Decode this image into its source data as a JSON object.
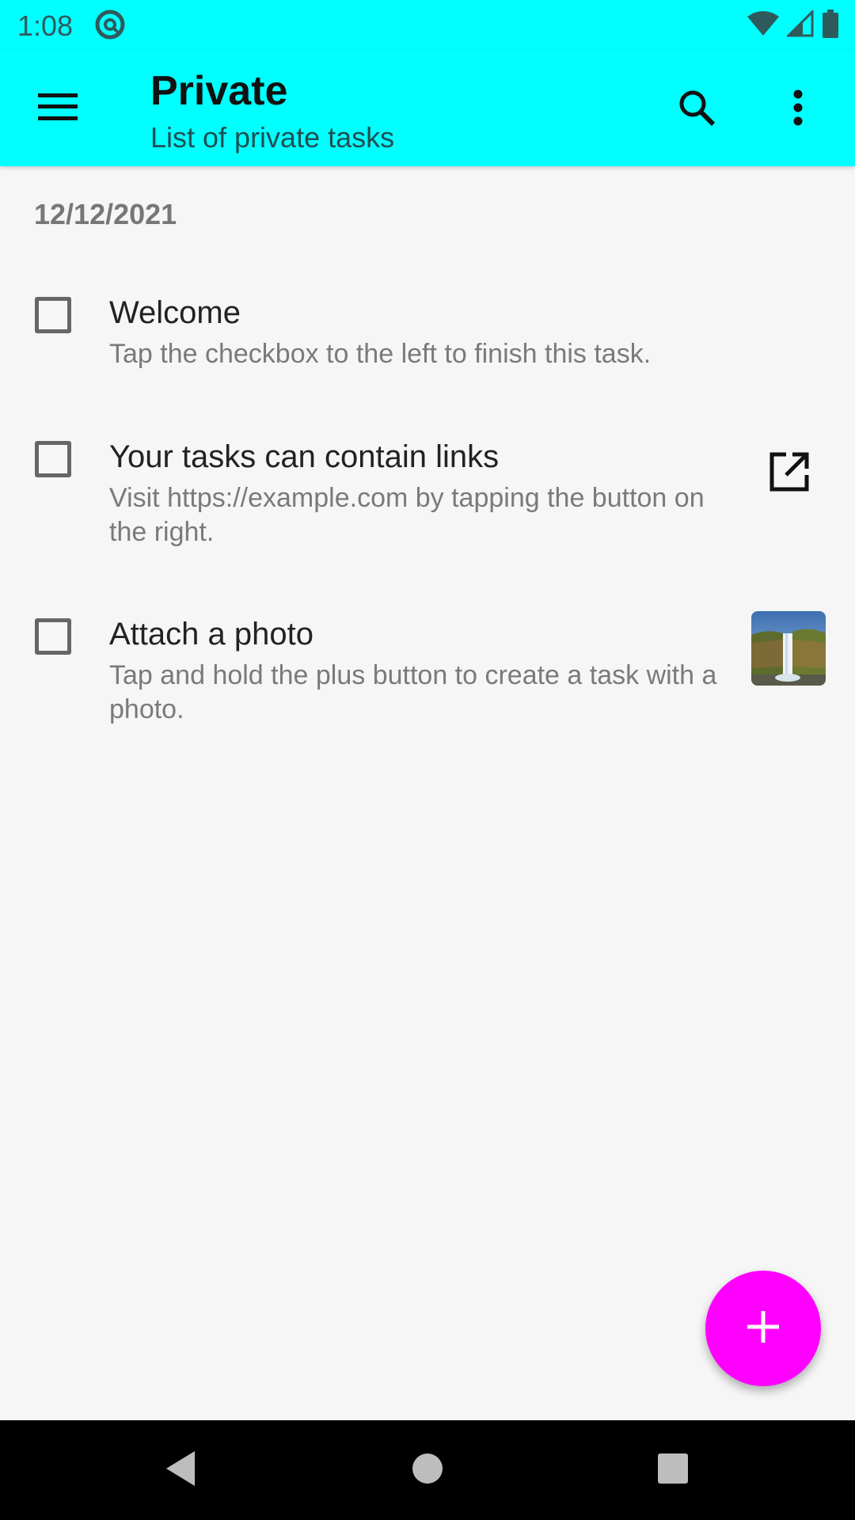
{
  "status_bar": {
    "time": "1:08",
    "icons": [
      "sync-icon",
      "wifi-icon",
      "signal-icon",
      "battery-icon"
    ]
  },
  "app_bar": {
    "title": "Private",
    "subtitle": "List of private tasks",
    "background": "#00ffff",
    "icons": [
      "menu-icon",
      "search-icon",
      "more-vert-icon"
    ]
  },
  "list": {
    "date_header": "12/12/2021",
    "tasks": [
      {
        "title": "Welcome",
        "description": "Tap the checkbox to the left to finish this task.",
        "checked": false,
        "action": ""
      },
      {
        "title": "Your tasks can contain links",
        "description": "Visit https://example.com by tapping the button on the right.",
        "checked": false,
        "action": "open-in-new-icon"
      },
      {
        "title": "Attach a photo",
        "description": "Tap and hold the plus button to create a task with a photo.",
        "checked": false,
        "action": "photo-thumbnail"
      }
    ]
  },
  "fab": {
    "icon": "plus-icon",
    "color": "#ff00ff"
  },
  "nav_bar": {
    "icons": [
      "back-icon",
      "home-icon",
      "recents-icon"
    ]
  }
}
